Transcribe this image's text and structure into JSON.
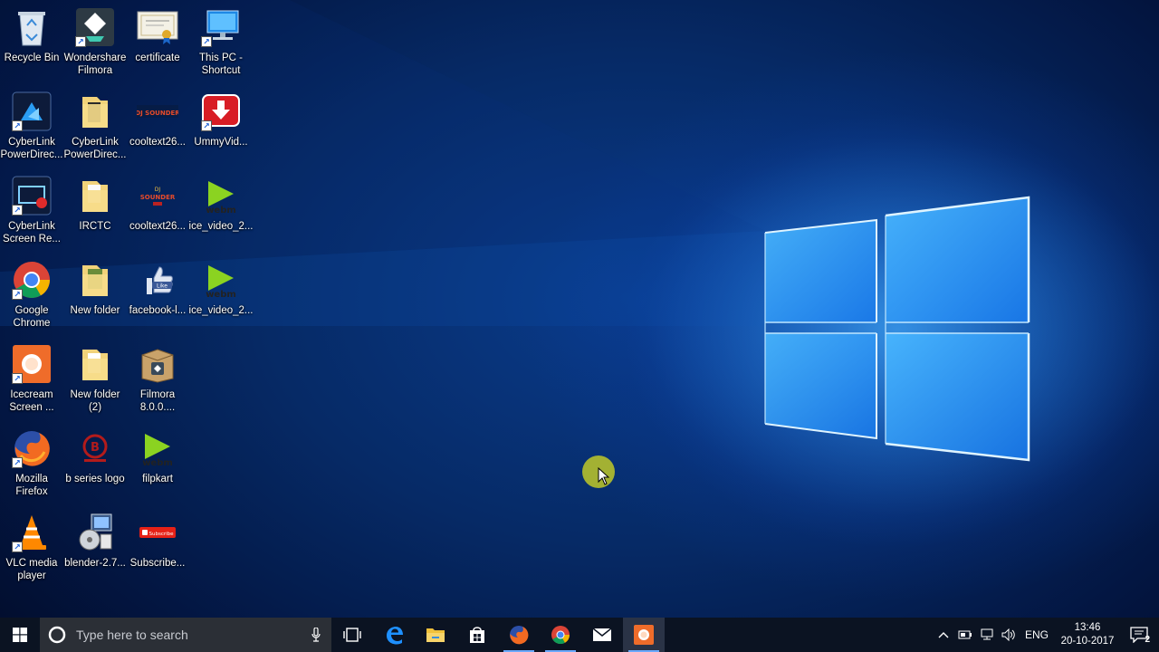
{
  "desktop": {
    "icons": [
      {
        "label": "Recycle Bin",
        "icon": "recycle-bin-icon"
      },
      {
        "label": "Wondershare Filmora",
        "icon": "filmora-icon"
      },
      {
        "label": "certificate",
        "icon": "certificate-image-icon"
      },
      {
        "label": "This PC - Shortcut",
        "icon": "this-pc-icon"
      },
      {
        "label": "CyberLink PowerDirec...",
        "icon": "powerdirector-icon"
      },
      {
        "label": "CyberLink PowerDirec...",
        "icon": "folder-icon"
      },
      {
        "label": "cooltext26...",
        "icon": "cooltext-image-icon"
      },
      {
        "label": "UmmyVid...",
        "icon": "ummy-video-icon"
      },
      {
        "label": "CyberLink Screen Re...",
        "icon": "screen-recorder-icon"
      },
      {
        "label": "IRCTC",
        "icon": "folder-icon"
      },
      {
        "label": "cooltext26...",
        "icon": "cooltext-image-icon"
      },
      {
        "label": "ice_video_2...",
        "icon": "webm-video-icon"
      },
      {
        "label": "Google Chrome",
        "icon": "chrome-icon"
      },
      {
        "label": "New folder",
        "icon": "folder-icon"
      },
      {
        "label": "facebook-l...",
        "icon": "facebook-like-icon"
      },
      {
        "label": "ice_video_2...",
        "icon": "webm-video-icon"
      },
      {
        "label": "Icecream Screen ...",
        "icon": "icecream-icon"
      },
      {
        "label": "New folder (2)",
        "icon": "folder-icon"
      },
      {
        "label": "Filmora 8.0.0....",
        "icon": "installer-box-icon"
      },
      {
        "label": "Mozilla Firefox",
        "icon": "firefox-icon"
      },
      {
        "label": "b series logo",
        "icon": "b-series-logo-icon"
      },
      {
        "label": "filpkart",
        "icon": "webm-video-icon"
      },
      {
        "label": "VLC media player",
        "icon": "vlc-icon"
      },
      {
        "label": "blender-2.7...",
        "icon": "installer-icon"
      },
      {
        "label": "Subscribe...",
        "icon": "subscribe-image-icon"
      }
    ]
  },
  "taskbar": {
    "search_placeholder": "Type here to search",
    "apps": [
      "task-view-icon",
      "edge-icon",
      "file-explorer-icon",
      "store-icon",
      "firefox-icon",
      "chrome-icon",
      "mail-icon",
      "icecream-recorder-icon"
    ],
    "tray": {
      "language": "ENG",
      "time": "13:46",
      "date": "20-10-2017",
      "notification_count": "2"
    }
  },
  "colors": {
    "taskbar_bg": "#0b1322",
    "search_bg": "#2b2f36",
    "accent": "#6aa9ff",
    "cursor_halo": "#bec828"
  }
}
